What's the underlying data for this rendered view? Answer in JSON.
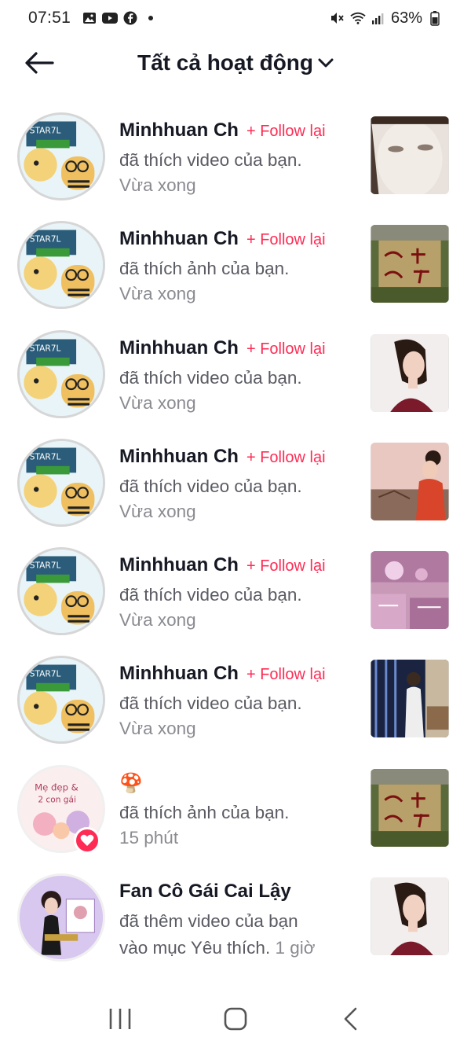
{
  "status_bar": {
    "time": "07:51",
    "battery": "63%",
    "left_icons": [
      "gallery-icon",
      "youtube-icon",
      "facebook-icon",
      "dot-icon"
    ],
    "right_icons": [
      "mute-icon",
      "wifi-icon",
      "signal-icon",
      "battery-icon"
    ]
  },
  "header": {
    "title": "Tất cả hoạt động",
    "back_icon": "arrow-left-icon",
    "dropdown_icon": "chevron-down-icon"
  },
  "colors": {
    "accent": "#fe2c55",
    "text_primary": "#161823",
    "text_secondary": "#5a5b63",
    "text_muted": "#8a8b91"
  },
  "activities": [
    {
      "username": "Minhhuan Ch",
      "follow": "+ Follow lại",
      "action": "đã thích video của bạn.",
      "time": "Vừa xong"
    },
    {
      "username": "Minhhuan Ch",
      "follow": "+ Follow lại",
      "action": "đã thích ảnh của bạn.",
      "time": "Vừa xong"
    },
    {
      "username": "Minhhuan Ch",
      "follow": "+ Follow lại",
      "action": "đã thích video của bạn.",
      "time": "Vừa xong"
    },
    {
      "username": "Minhhuan Ch",
      "follow": "+ Follow lại",
      "action": "đã thích video của bạn.",
      "time": "Vừa xong"
    },
    {
      "username": "Minhhuan Ch",
      "follow": "+ Follow lại",
      "action": "đã thích video của bạn.",
      "time": "Vừa xong"
    },
    {
      "username": "Minhhuan Ch",
      "follow": "+ Follow lại",
      "action": "đã thích video của bạn.",
      "time": "Vừa xong"
    },
    {
      "username": "🍄",
      "action": "đã thích ảnh của bạn.",
      "time": "15 phút"
    },
    {
      "username": "Fan Cô Gái Cai Lậy",
      "action": "đã thêm video của bạn",
      "action2": "vào mục Yêu thích.",
      "time": "1 giờ"
    }
  ],
  "navbar": {
    "recent_icon": "recent-apps-icon",
    "home_icon": "home-icon",
    "back_icon": "back-chevron-icon"
  }
}
